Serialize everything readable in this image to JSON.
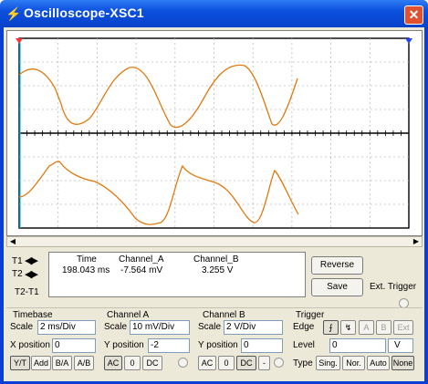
{
  "window": {
    "title": "Oscilloscope-XSC1",
    "close_label": "✕"
  },
  "readout": {
    "headers": [
      "Time",
      "Channel_A",
      "Channel_B"
    ],
    "t1_label": "T1",
    "t2_label": "T2",
    "t2t1_label": "T2-T1",
    "row": {
      "time": "198.043 ms",
      "channel_a": "-7.564 mV",
      "channel_b": "3.255 V"
    }
  },
  "buttons": {
    "reverse": "Reverse",
    "save": "Save",
    "ext_trigger": "Ext. Trigger"
  },
  "timebase": {
    "title": "Timebase",
    "scale_label": "Scale",
    "scale_value": "2 ms/Div",
    "xpos_label": "X position",
    "xpos_value": "0",
    "modes": [
      "Y/T",
      "Add",
      "B/A",
      "A/B"
    ]
  },
  "channel_a": {
    "title": "Channel A",
    "scale_label": "Scale",
    "scale_value": "10 mV/Div",
    "ypos_label": "Y position",
    "ypos_value": "-2",
    "coupling": [
      "AC",
      "0",
      "DC"
    ]
  },
  "channel_b": {
    "title": "Channel B",
    "scale_label": "Scale",
    "scale_value": "2  V/Div",
    "ypos_label": "Y position",
    "ypos_value": "0",
    "coupling": [
      "AC",
      "0",
      "DC",
      "-"
    ]
  },
  "trigger": {
    "title": "Trigger",
    "edge_label": "Edge",
    "edge_buttons": [
      "A",
      "B",
      "Ext"
    ],
    "level_label": "Level",
    "level_value": "0",
    "level_unit": "V",
    "type_label": "Type",
    "types": [
      "Sing.",
      "Nor.",
      "Auto",
      "None"
    ]
  },
  "colors": {
    "trace": "#e07a10",
    "cursor1": "#ff3333",
    "cursor2": "#00ccff",
    "title_bar": "#0b50de"
  }
}
